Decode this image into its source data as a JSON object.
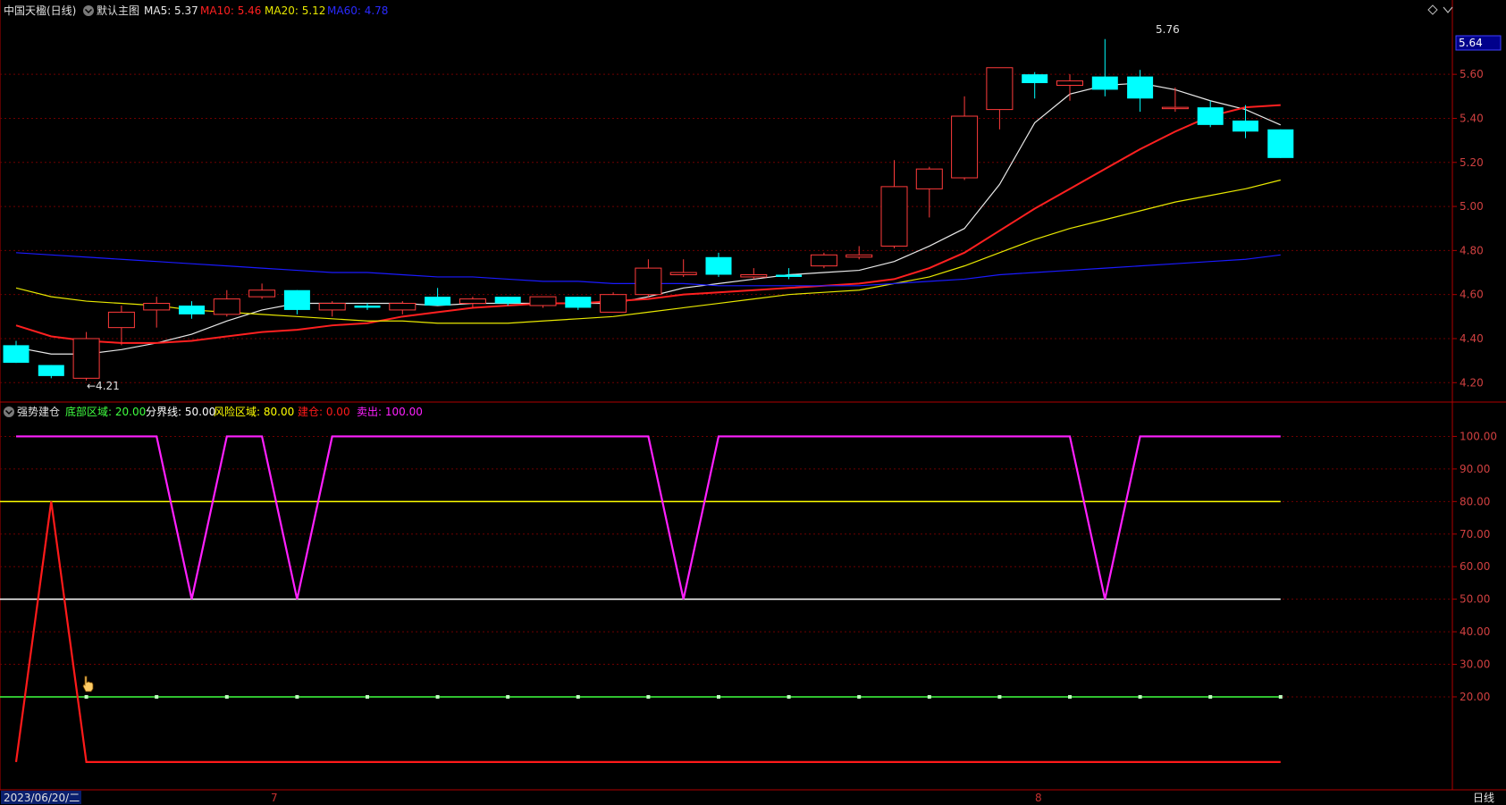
{
  "header": {
    "stock_name": "中国天楹(日线)",
    "main_chart_label": "默认主图",
    "ma5_label": "MA5: 5.37",
    "ma10_label": "MA10: 5.46",
    "ma20_label": "MA20: 5.12",
    "ma60_label": "MA60: 4.78"
  },
  "indicator_header": {
    "name": "强势建仓",
    "bottom_zone": "底部区域: 20.00",
    "divider": "分界线: 50.00",
    "risk_zone": "风险区域: 80.00",
    "build": "建仓: 0.00",
    "sell": "卖出: 100.00"
  },
  "footer": {
    "date": "2023/06/20/二",
    "month_7": "7",
    "month_8": "8",
    "period": "日线"
  },
  "colors": {
    "up": "#ff3b3b",
    "down": "#00ffff",
    "ma5": "#e8e8e8",
    "ma10": "#ff2020",
    "ma20": "#e8e800",
    "ma60": "#1a1aff",
    "grid": "#6e0000",
    "axis": "#b00000",
    "sell_line": "#ff20ff",
    "build_line": "#ff1a1a",
    "risk_line": "#ffff00",
    "divider_line": "#ffffff",
    "bottom_line": "#40ff40"
  },
  "chart_data": [
    {
      "type": "candlestick",
      "title": "中国天楹(日线)",
      "ylim": [
        4.12,
        5.84
      ],
      "y_ticks": [
        "5.60",
        "5.40",
        "5.20",
        "5.00",
        "4.80",
        "4.60",
        "4.40",
        "4.20"
      ],
      "current_price_tag": "5.64",
      "annotations": {
        "high_label": "5.76",
        "low_label": "←4.21"
      },
      "candles": [
        {
          "o": 4.37,
          "h": 4.39,
          "l": 4.29,
          "c": 4.29
        },
        {
          "o": 4.28,
          "h": 4.28,
          "l": 4.22,
          "c": 4.23
        },
        {
          "o": 4.22,
          "h": 4.43,
          "l": 4.21,
          "c": 4.4
        },
        {
          "o": 4.45,
          "h": 4.55,
          "l": 4.37,
          "c": 4.52
        },
        {
          "o": 4.53,
          "h": 4.59,
          "l": 4.45,
          "c": 4.56
        },
        {
          "o": 4.55,
          "h": 4.57,
          "l": 4.49,
          "c": 4.51
        },
        {
          "o": 4.51,
          "h": 4.62,
          "l": 4.5,
          "c": 4.58
        },
        {
          "o": 4.59,
          "h": 4.65,
          "l": 4.58,
          "c": 4.62
        },
        {
          "o": 4.62,
          "h": 4.62,
          "l": 4.51,
          "c": 4.53
        },
        {
          "o": 4.53,
          "h": 4.57,
          "l": 4.5,
          "c": 4.56
        },
        {
          "o": 4.55,
          "h": 4.56,
          "l": 4.53,
          "c": 4.54
        },
        {
          "o": 4.53,
          "h": 4.57,
          "l": 4.51,
          "c": 4.56
        },
        {
          "o": 4.59,
          "h": 4.63,
          "l": 4.55,
          "c": 4.55
        },
        {
          "o": 4.56,
          "h": 4.59,
          "l": 4.54,
          "c": 4.58
        },
        {
          "o": 4.59,
          "h": 4.59,
          "l": 4.55,
          "c": 4.56
        },
        {
          "o": 4.55,
          "h": 4.59,
          "l": 4.54,
          "c": 4.59
        },
        {
          "o": 4.59,
          "h": 4.59,
          "l": 4.53,
          "c": 4.54
        },
        {
          "o": 4.52,
          "h": 4.61,
          "l": 4.52,
          "c": 4.6
        },
        {
          "o": 4.6,
          "h": 4.76,
          "l": 4.59,
          "c": 4.72
        },
        {
          "o": 4.69,
          "h": 4.76,
          "l": 4.68,
          "c": 4.7
        },
        {
          "o": 4.77,
          "h": 4.79,
          "l": 4.68,
          "c": 4.69
        },
        {
          "o": 4.68,
          "h": 4.72,
          "l": 4.67,
          "c": 4.69
        },
        {
          "o": 4.69,
          "h": 4.72,
          "l": 4.67,
          "c": 4.68
        },
        {
          "o": 4.73,
          "h": 4.79,
          "l": 4.72,
          "c": 4.78
        },
        {
          "o": 4.77,
          "h": 4.82,
          "l": 4.76,
          "c": 4.78
        },
        {
          "o": 4.82,
          "h": 5.21,
          "l": 4.81,
          "c": 5.09
        },
        {
          "o": 5.08,
          "h": 5.18,
          "l": 4.95,
          "c": 5.17
        },
        {
          "o": 5.13,
          "h": 5.5,
          "l": 5.12,
          "c": 5.41
        },
        {
          "o": 5.44,
          "h": 5.63,
          "l": 5.35,
          "c": 5.63
        },
        {
          "o": 5.6,
          "h": 5.61,
          "l": 5.49,
          "c": 5.56
        },
        {
          "o": 5.55,
          "h": 5.6,
          "l": 5.48,
          "c": 5.57
        },
        {
          "o": 5.59,
          "h": 5.76,
          "l": 5.5,
          "c": 5.53
        },
        {
          "o": 5.59,
          "h": 5.62,
          "l": 5.43,
          "c": 5.49
        },
        {
          "o": 5.45,
          "h": 5.54,
          "l": 5.43,
          "c": 5.45
        },
        {
          "o": 5.45,
          "h": 5.48,
          "l": 5.36,
          "c": 5.37
        },
        {
          "o": 5.39,
          "h": 5.46,
          "l": 5.31,
          "c": 5.34
        },
        {
          "o": 5.35,
          "h": 5.35,
          "l": 5.22,
          "c": 5.22
        }
      ],
      "ma_series": [
        {
          "name": "MA5",
          "values": [
            4.36,
            4.33,
            4.33,
            4.35,
            4.38,
            4.42,
            4.48,
            4.53,
            4.56,
            4.56,
            4.56,
            4.56,
            4.55,
            4.56,
            4.56,
            4.56,
            4.56,
            4.56,
            4.59,
            4.63,
            4.65,
            4.67,
            4.69,
            4.7,
            4.71,
            4.75,
            4.82,
            4.9,
            5.1,
            5.38,
            5.51,
            5.55,
            5.56,
            5.53,
            5.48,
            5.44,
            5.37
          ]
        },
        {
          "name": "MA10",
          "values": [
            4.46,
            4.41,
            4.39,
            4.38,
            4.38,
            4.39,
            4.41,
            4.43,
            4.44,
            4.46,
            4.47,
            4.5,
            4.52,
            4.54,
            4.55,
            4.56,
            4.56,
            4.57,
            4.58,
            4.6,
            4.61,
            4.62,
            4.63,
            4.64,
            4.65,
            4.67,
            4.72,
            4.79,
            4.89,
            4.99,
            5.08,
            5.17,
            5.26,
            5.34,
            5.41,
            5.45,
            5.46
          ]
        },
        {
          "name": "MA20",
          "values": [
            4.63,
            4.59,
            4.57,
            4.56,
            4.55,
            4.53,
            4.52,
            4.51,
            4.5,
            4.49,
            4.48,
            4.48,
            4.47,
            4.47,
            4.47,
            4.48,
            4.49,
            4.5,
            4.52,
            4.54,
            4.56,
            4.58,
            4.6,
            4.61,
            4.62,
            4.65,
            4.68,
            4.73,
            4.79,
            4.85,
            4.9,
            4.94,
            4.98,
            5.02,
            5.05,
            5.08,
            5.12
          ]
        },
        {
          "name": "MA60",
          "values": [
            4.79,
            4.78,
            4.77,
            4.76,
            4.75,
            4.74,
            4.73,
            4.72,
            4.71,
            4.7,
            4.7,
            4.69,
            4.68,
            4.68,
            4.67,
            4.66,
            4.66,
            4.65,
            4.65,
            4.65,
            4.64,
            4.64,
            4.64,
            4.64,
            4.64,
            4.65,
            4.66,
            4.67,
            4.69,
            4.7,
            4.71,
            4.72,
            4.73,
            4.74,
            4.75,
            4.76,
            4.78
          ]
        }
      ]
    },
    {
      "type": "line",
      "title": "强势建仓",
      "ylim": [
        -8,
        110
      ],
      "y_ticks": [
        "100.00",
        "90.00",
        "80.00",
        "70.00",
        "60.00",
        "50.00",
        "40.00",
        "30.00",
        "20.00"
      ],
      "series": [
        {
          "name": "卖出",
          "values": [
            100,
            100,
            100,
            100,
            100,
            50,
            100,
            100,
            50,
            100,
            100,
            100,
            100,
            100,
            100,
            100,
            100,
            100,
            100,
            50,
            100,
            100,
            100,
            100,
            100,
            100,
            100,
            100,
            100,
            100,
            100,
            50,
            100,
            100,
            100,
            100,
            100
          ]
        },
        {
          "name": "建仓",
          "values": [
            0,
            80,
            0,
            0,
            0,
            0,
            0,
            0,
            0,
            0,
            0,
            0,
            0,
            0,
            0,
            0,
            0,
            0,
            0,
            0,
            0,
            0,
            0,
            0,
            0,
            0,
            0,
            0,
            0,
            0,
            0,
            0,
            0,
            0,
            0,
            0,
            0
          ]
        },
        {
          "name": "风险区域",
          "values": [
            80
          ]
        },
        {
          "name": "分界线",
          "values": [
            50
          ]
        },
        {
          "name": "底部区域",
          "values": [
            20
          ]
        }
      ]
    }
  ]
}
